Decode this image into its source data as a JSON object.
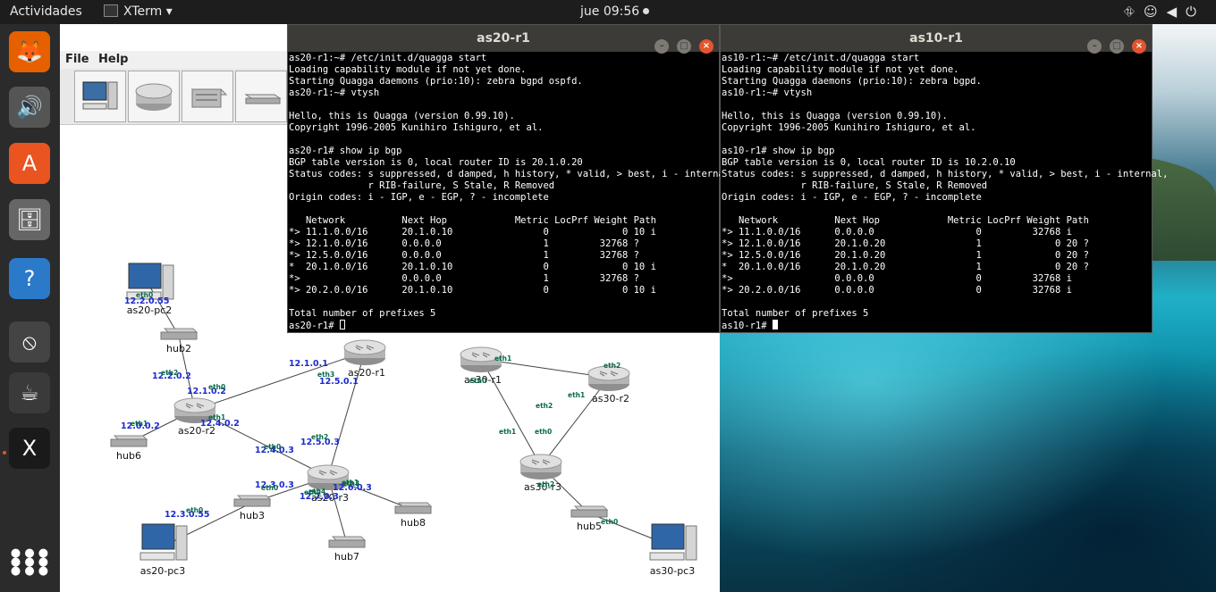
{
  "topbar": {
    "activities": "Actividades",
    "app_name": "XTerm ▾",
    "clock": "jue 09:56"
  },
  "dock": [
    {
      "name": "firefox-icon",
      "glyph": "🦊"
    },
    {
      "name": "rhythmbox-icon",
      "glyph": "🔊"
    },
    {
      "name": "software-center-icon",
      "glyph": "A"
    },
    {
      "name": "file-cabinet-icon",
      "glyph": "🗄"
    },
    {
      "name": "help-icon",
      "glyph": "?"
    },
    {
      "name": "no-entry-icon",
      "glyph": "⦸"
    },
    {
      "name": "java-icon",
      "glyph": "☕"
    },
    {
      "name": "xterm-icon",
      "glyph": "X"
    },
    {
      "name": "app-grid-icon",
      "glyph": "⋮⋮⋮"
    }
  ],
  "netapp": {
    "menu": {
      "file": "File",
      "help": "Help"
    },
    "tools": [
      "pc-tool-icon",
      "router-tool-icon",
      "switch-tool-icon",
      "hub-tool-icon"
    ]
  },
  "network": {
    "nodes": [
      {
        "id": "as20-pc2",
        "label": "as20-pc2",
        "type": "pc"
      },
      {
        "id": "hub2",
        "label": "hub2",
        "type": "hub"
      },
      {
        "id": "as20-r2",
        "label": "as20-r2",
        "type": "router"
      },
      {
        "id": "as20-r1",
        "label": "as20-r1",
        "type": "router"
      },
      {
        "id": "hub6",
        "label": "hub6",
        "type": "hub"
      },
      {
        "id": "as20-r3",
        "label": "as20-r3",
        "type": "router"
      },
      {
        "id": "hub3",
        "label": "hub3",
        "type": "hub"
      },
      {
        "id": "hub8",
        "label": "hub8",
        "type": "hub"
      },
      {
        "id": "hub7",
        "label": "hub7",
        "type": "hub"
      },
      {
        "id": "as20-pc3",
        "label": "as20-pc3",
        "type": "pc"
      },
      {
        "id": "as30-r1",
        "label": "as30-r1",
        "type": "router"
      },
      {
        "id": "as30-r2",
        "label": "as30-r2",
        "type": "router"
      },
      {
        "id": "as30-r3",
        "label": "as30-r3",
        "type": "router"
      },
      {
        "id": "hub5",
        "label": "hub5",
        "type": "hub"
      },
      {
        "id": "as30-pc3",
        "label": "as30-pc3",
        "type": "pc"
      }
    ],
    "ip_labels": [
      "12.2.0.55",
      "12.2.0.2",
      "12.1.0.2",
      "12.1.0.1",
      "12.5.0.1",
      "12.0.0.2",
      "12.4.0.2",
      "12.4.0.3",
      "12.5.0.3",
      "12.3.0.3",
      "12.6.0.3",
      "12.7.0.3",
      "12.3.0.55"
    ],
    "if_labels": [
      "eth0",
      "eth2",
      "eth0",
      "eth3",
      "eth1",
      "eth1",
      "eth0",
      "eth2",
      "eth1",
      "eth0",
      "eth3",
      "eth2",
      "eth4",
      "eth0",
      "eth2",
      "eth1",
      "eth0",
      "eth2",
      "eth1",
      "eth1",
      "eth0",
      "eth2",
      "eth0"
    ]
  },
  "term_as20": {
    "title": "as20-r1",
    "lines": [
      "as20-r1:~# /etc/init.d/quagga start",
      "Loading capability module if not yet done.",
      "Starting Quagga daemons (prio:10): zebra bgpd ospfd.",
      "as20-r1:~# vtysh",
      "",
      "Hello, this is Quagga (version 0.99.10).",
      "Copyright 1996-2005 Kunihiro Ishiguro, et al.",
      "",
      "as20-r1# show ip bgp",
      "BGP table version is 0, local router ID is 20.1.0.20",
      "Status codes: s suppressed, d damped, h history, * valid, > best, i - internal,",
      "              r RIB-failure, S Stale, R Removed",
      "Origin codes: i - IGP, e - EGP, ? - incomplete",
      "",
      "   Network          Next Hop            Metric LocPrf Weight Path",
      "*> 11.1.0.0/16      20.1.0.10                0             0 10 i",
      "*> 12.1.0.0/16      0.0.0.0                  1         32768 ?",
      "*> 12.5.0.0/16      0.0.0.0                  1         32768 ?",
      "*  20.1.0.0/16      20.1.0.10                0             0 10 i",
      "*>                  0.0.0.0                  1         32768 ?",
      "*> 20.2.0.0/16      20.1.0.10                0             0 10 i",
      "",
      "Total number of prefixes 5"
    ],
    "prompt": "as20-r1# "
  },
  "term_as10": {
    "title": "as10-r1",
    "lines": [
      "as10-r1:~# /etc/init.d/quagga start",
      "Loading capability module if not yet done.",
      "Starting Quagga daemons (prio:10): zebra bgpd.",
      "as10-r1:~# vtysh",
      "",
      "Hello, this is Quagga (version 0.99.10).",
      "Copyright 1996-2005 Kunihiro Ishiguro, et al.",
      "",
      "as10-r1# show ip bgp",
      "BGP table version is 0, local router ID is 10.2.0.10",
      "Status codes: s suppressed, d damped, h history, * valid, > best, i - internal,",
      "              r RIB-failure, S Stale, R Removed",
      "Origin codes: i - IGP, e - EGP, ? - incomplete",
      "",
      "   Network          Next Hop            Metric LocPrf Weight Path",
      "*> 11.1.0.0/16      0.0.0.0                  0         32768 i",
      "*> 12.1.0.0/16      20.1.0.20                1             0 20 ?",
      "*> 12.5.0.0/16      20.1.0.20                1             0 20 ?",
      "*  20.1.0.0/16      20.1.0.20                1             0 20 ?",
      "*>                  0.0.0.0                  0         32768 i",
      "*> 20.2.0.0/16      0.0.0.0                  0         32768 i",
      "",
      "Total number of prefixes 5"
    ],
    "prompt": "as10-r1# "
  },
  "window_buttons": {
    "minimize": "–",
    "maximize": "□",
    "close": "×"
  }
}
